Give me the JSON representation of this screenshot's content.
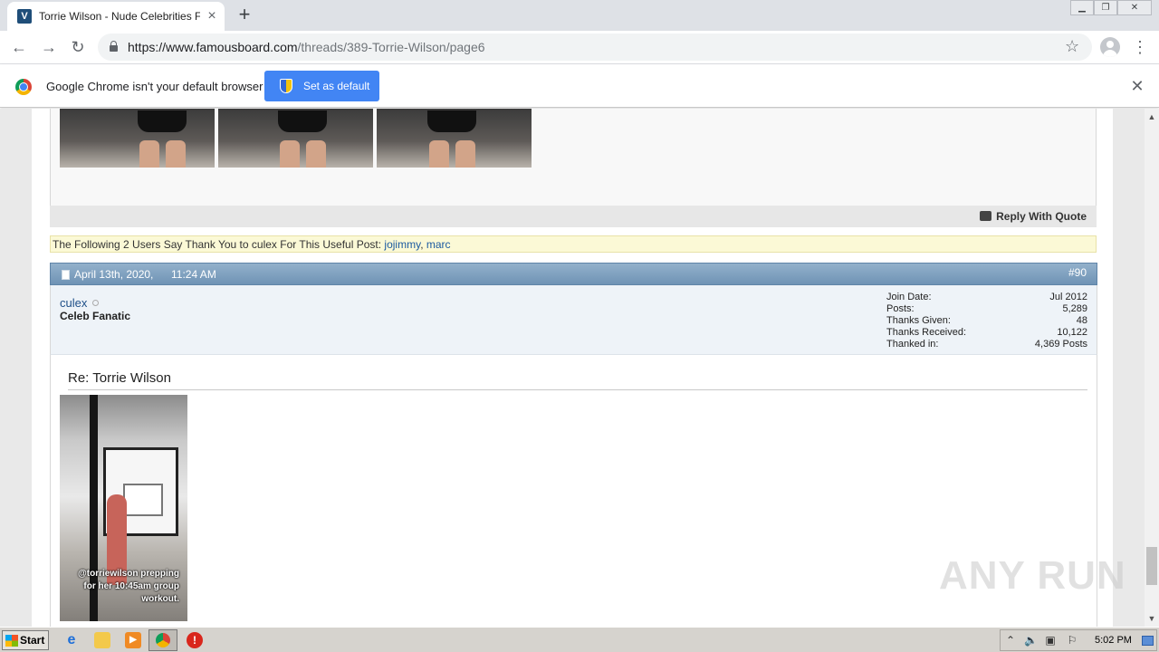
{
  "browser": {
    "tab": {
      "title": "Torrie Wilson - Nude Celebrities Forum",
      "favicon": "V"
    },
    "url": {
      "host": "https://www.famousboard.com",
      "path": "/threads/389-Torrie-Wilson/page6"
    },
    "infobar": {
      "message": "Google Chrome isn't your default browser",
      "button": "Set as default"
    }
  },
  "page": {
    "reply_with_quote": "Reply With Quote",
    "thanks": {
      "text": "The Following 2 Users Say Thank You to culex For This Useful Post:",
      "users": [
        "jojimmy",
        "marc"
      ],
      "separator": ", "
    },
    "post": {
      "date": "April 13th, 2020,",
      "time": "11:24 AM",
      "number": "#90",
      "username": "culex",
      "user_title": "Celeb Fanatic",
      "stats": [
        {
          "label": "Join Date:",
          "value": "Jul 2012"
        },
        {
          "label": "Posts:",
          "value": "5,289"
        },
        {
          "label": "Thanks Given:",
          "value": "48"
        },
        {
          "label": "Thanks Received:",
          "value": "10,122"
        },
        {
          "label": "Thanked in:",
          "value": "4,369 Posts"
        }
      ],
      "title": "Re: Torrie Wilson",
      "image_caption": "@torriewilson prepping for her 10:45am group workout."
    },
    "watermark": "ANY RUN"
  },
  "taskbar": {
    "start": "Start",
    "clock": "5:02 PM"
  },
  "colors": {
    "post_header": "#7b9cbc",
    "thanks_bg": "#fbf9d6",
    "link": "#1c5aa0",
    "chrome_accent": "#4285f4"
  }
}
